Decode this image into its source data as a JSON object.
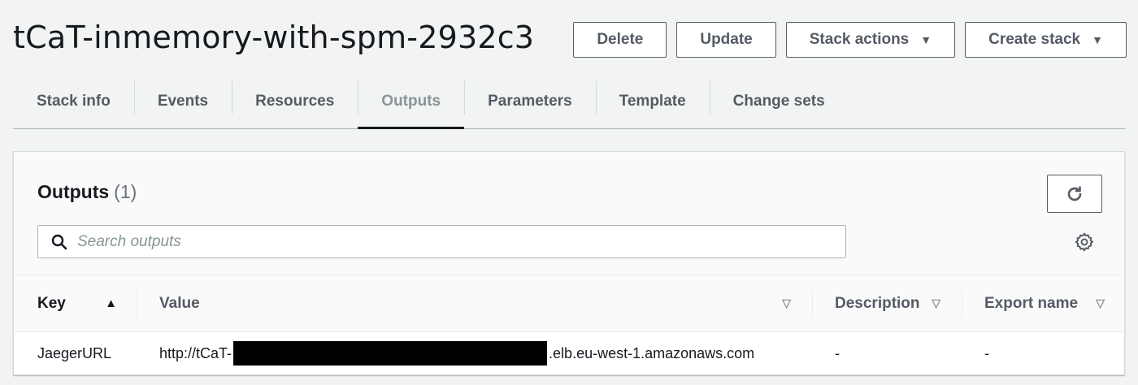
{
  "header": {
    "stack_name": "tCaT-inmemory-with-spm-2932c3",
    "actions": {
      "delete": "Delete",
      "update": "Update",
      "stack_actions": "Stack actions",
      "create_stack": "Create stack"
    }
  },
  "tabs": [
    {
      "label": "Stack info"
    },
    {
      "label": "Events"
    },
    {
      "label": "Resources"
    },
    {
      "label": "Outputs",
      "active": true
    },
    {
      "label": "Parameters"
    },
    {
      "label": "Template"
    },
    {
      "label": "Change sets"
    }
  ],
  "outputs_panel": {
    "title": "Outputs",
    "count": "(1)",
    "search": {
      "placeholder": "Search outputs",
      "value": ""
    },
    "columns": {
      "key": "Key",
      "value": "Value",
      "description": "Description",
      "export_name": "Export name"
    },
    "rows": [
      {
        "key": "JaegerURL",
        "value_prefix": "http://tCaT-",
        "value_suffix": ".elb.eu-west-1.amazonaws.com",
        "description": "-",
        "export_name": "-"
      }
    ]
  },
  "icons": {
    "caret": "caret-down-icon",
    "refresh": "refresh-icon",
    "search": "search-icon",
    "settings": "gear-icon",
    "sort_asc": "sort-ascending-icon",
    "sort": "sort-descending-icon"
  },
  "colors": {
    "page_bg": "#f2f3f3",
    "text": "#16191f",
    "secondary": "#545b64",
    "border": "#aab7b8"
  }
}
